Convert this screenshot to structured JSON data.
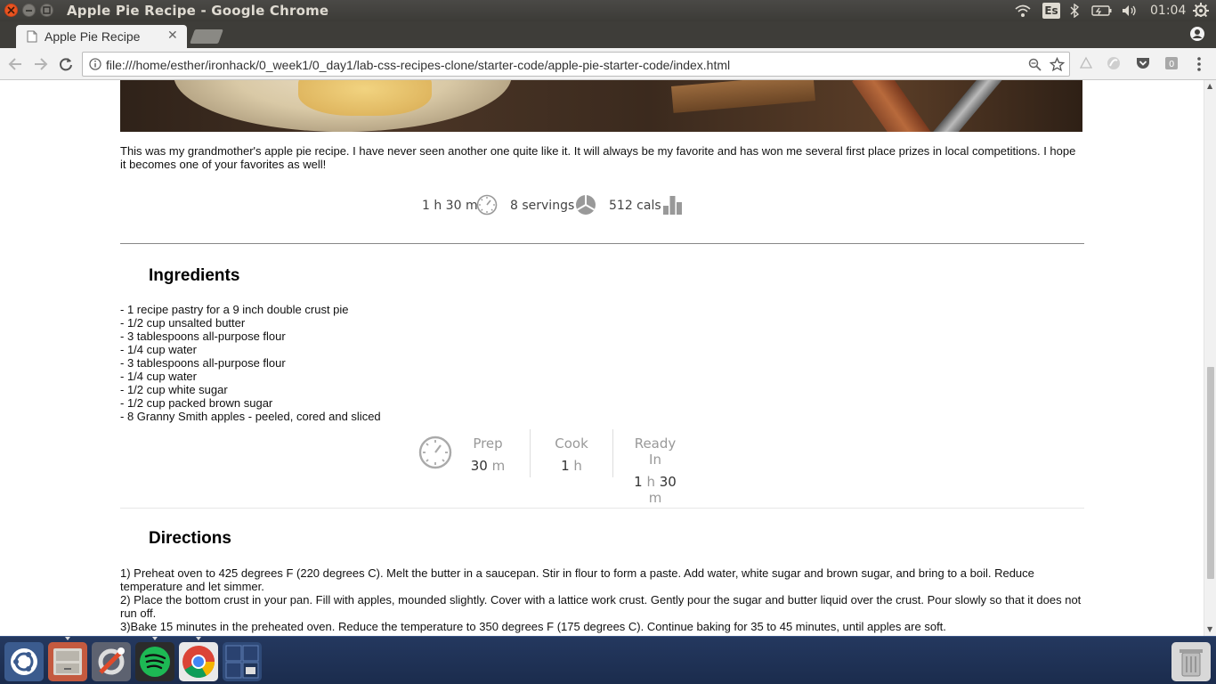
{
  "window": {
    "title": "Apple Pie Recipe - Google Chrome",
    "clock": "01:04",
    "keyboard_layout": "Es"
  },
  "browser": {
    "tab_title": "Apple Pie Recipe",
    "url": "file:///home/esther/ironhack/0_week1/0_day1/lab-css-recipes-clone/starter-code/apple-pie-starter-code/index.html"
  },
  "recipe": {
    "intro": "This was my grandmother's apple pie recipe. I have never seen another one quite like it. It will always be my favorite and has won me several first place prizes in local competitions. I hope it becomes one of your favorites as well!",
    "stats": {
      "time": "1 h 30 m",
      "servings": "8 servings",
      "calories": "512 cals"
    },
    "ingredients_title": "Ingredients",
    "ingredients": [
      "- 1 recipe pastry for a 9 inch double crust pie",
      "- 1/2 cup unsalted butter",
      "- 3 tablespoons all-purpose flour",
      "- 1/4 cup water",
      "- 3 tablespoons all-purpose flour",
      "- 1/4 cup water",
      "- 1/2 cup white sugar",
      "- 1/2 cup packed brown sugar",
      "- 8 Granny Smith apples - peeled, cored and sliced"
    ],
    "times": {
      "prep": {
        "label": "Prep",
        "num": "30",
        "unit": "m"
      },
      "cook": {
        "label": "Cook",
        "num": "1",
        "unit": "h"
      },
      "ready": {
        "label": "Ready In",
        "num1": "1",
        "unit1": "h",
        "num2": "30",
        "unit2": "m"
      }
    },
    "directions_title": "Directions",
    "directions": [
      "1) Preheat oven to 425 degrees F (220 degrees C). Melt the butter in a saucepan. Stir in flour to form a paste. Add water, white sugar and brown sugar, and bring to a boil. Reduce temperature and let simmer.",
      "2) Place the bottom crust in your pan. Fill with apples, mounded slightly. Cover with a lattice work crust. Gently pour the sugar and butter liquid over the crust. Pour slowly so that it does not run off.",
      "3)Bake 15 minutes in the preheated oven. Reduce the temperature to 350 degrees F (175 degrees C). Continue baking for 35 to 45 minutes, until apples are soft."
    ]
  },
  "launcher": {
    "apps": [
      "ubuntu-dash",
      "files",
      "system-settings",
      "spotify",
      "chrome",
      "workspace-switcher"
    ]
  },
  "colors": {
    "ubuntu_orange": "#e95420",
    "launcher_bg": "#1b2c4d",
    "spotify_green": "#1db954"
  }
}
